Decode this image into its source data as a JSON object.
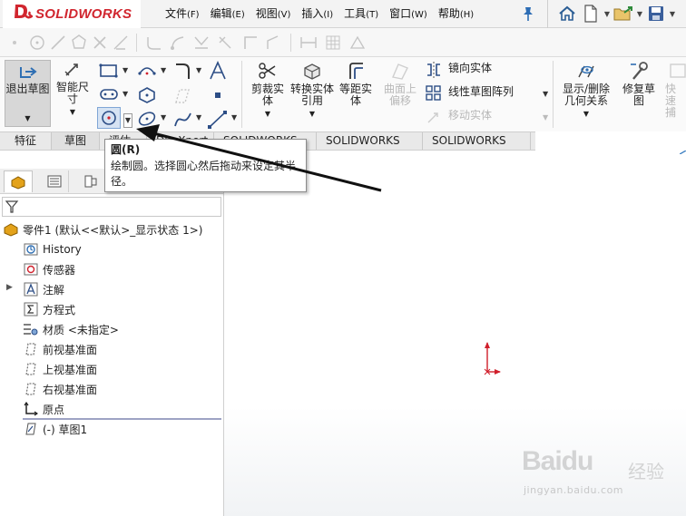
{
  "app": {
    "logo_ds": "Ꮷ",
    "logo_word": "SOLIDWORKS",
    "colors": {
      "brand": "#d1262f",
      "origin_red": "#d01f2b",
      "tab_bg": "#e9e9e9"
    }
  },
  "menu": [
    {
      "label": "文件",
      "hotkey": "(F)"
    },
    {
      "label": "编辑",
      "hotkey": "(E)"
    },
    {
      "label": "视图",
      "hotkey": "(V)"
    },
    {
      "label": "插入",
      "hotkey": "(I)"
    },
    {
      "label": "工具",
      "hotkey": "(T)"
    },
    {
      "label": "窗口",
      "hotkey": "(W)"
    },
    {
      "label": "帮助",
      "hotkey": "(H)"
    }
  ],
  "quick_access": {
    "icons": [
      "home-icon",
      "new-document-icon",
      "open-folder-icon",
      "save-icon"
    ]
  },
  "ribbon": {
    "exit_sketch": "退出草图",
    "smart_dim": "智能尺寸",
    "trim": "剪裁实体",
    "convert": "转换实体引用",
    "offset": "等距实体",
    "surface_offset": "曲面上偏移",
    "mirror": "镜向实体",
    "linear_pattern": "线性草图阵列",
    "move": "移动实体",
    "relations": "显示/删除几何关系",
    "repair": "修复草图",
    "quick": "快速捕"
  },
  "tabs": [
    "特征",
    "草图",
    "评估",
    "DimXpert",
    "SOLIDWORKS 插件",
    "SOLIDWORKS MBD",
    "SOLIDWORKS CAM"
  ],
  "tooltip": {
    "title": "圆(R)",
    "body": "绘制圆。选择圆心然后拖动来设定其半径。"
  },
  "tree": {
    "root": "零件1 (默认<<默认>_显示状态 1>)",
    "items": [
      "History",
      "传感器",
      "注解",
      "方程式",
      "材质 <未指定>",
      "前视基准面",
      "上视基准面",
      "右视基准面",
      "原点",
      "(-) 草图1"
    ]
  },
  "watermark": {
    "brand": "Baidu",
    "cn": "经验",
    "url": "jingyan.baidu.com"
  }
}
